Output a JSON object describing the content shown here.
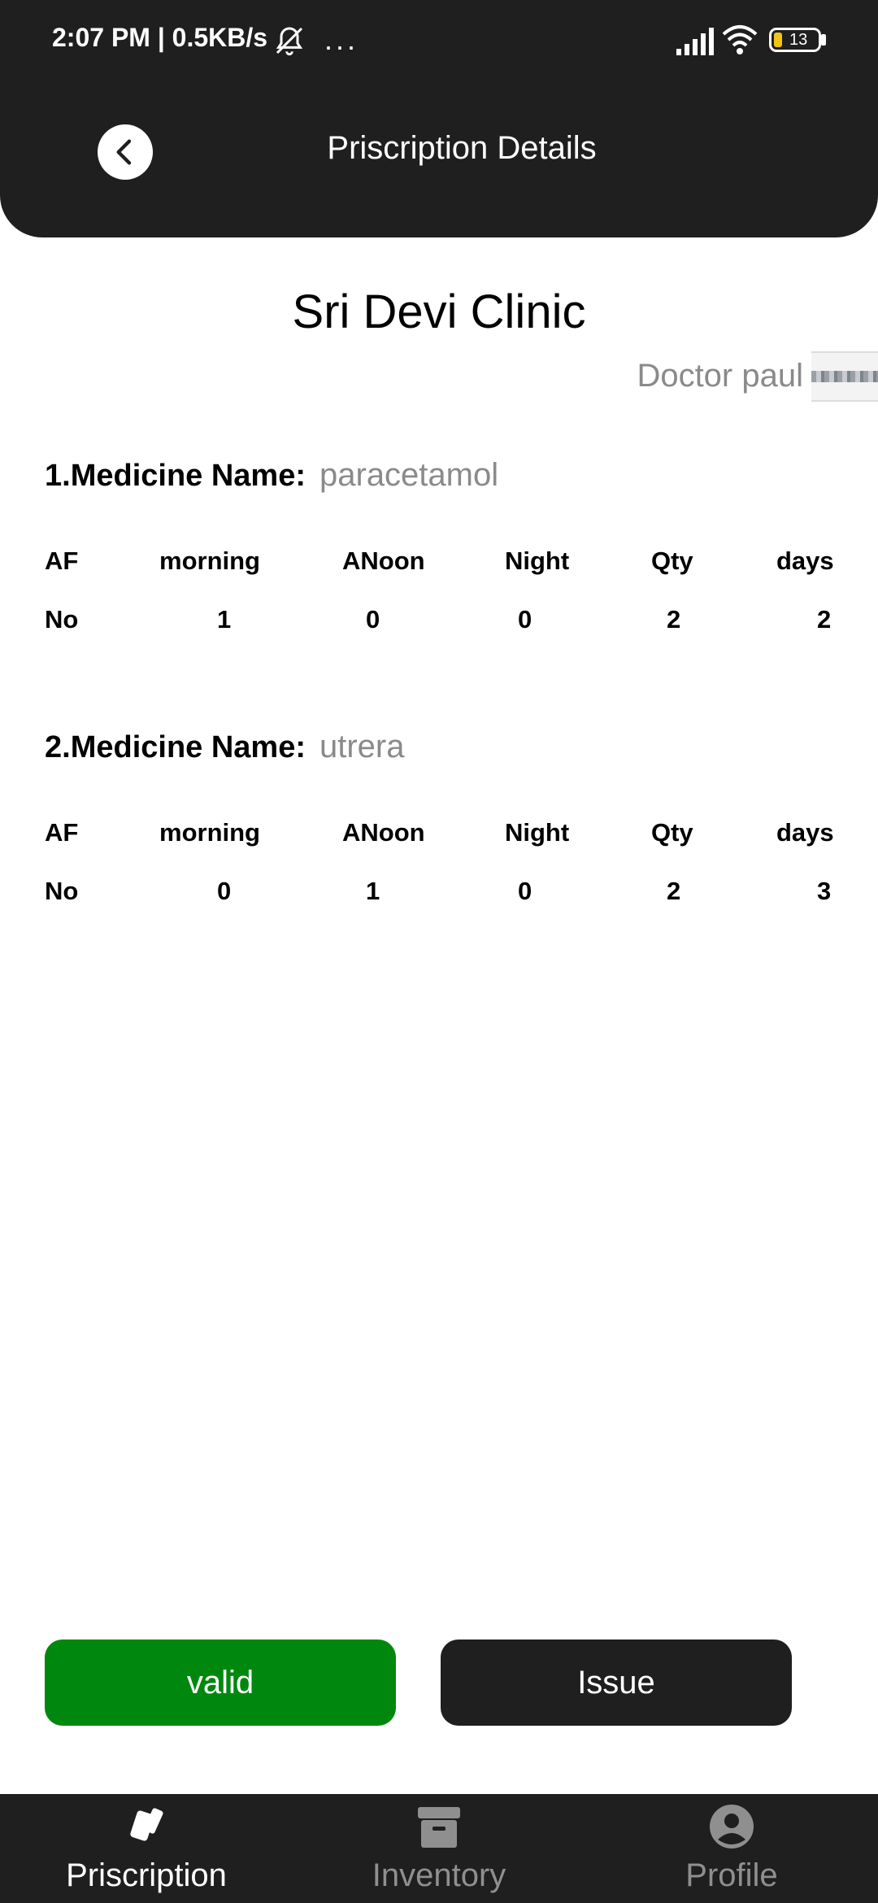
{
  "status_bar": {
    "time": "2:07 PM | 0.5KB/s",
    "more": "···",
    "battery": "13"
  },
  "app_bar": {
    "title": "Priscription Details"
  },
  "clinic": {
    "name": "Sri Devi Clinic",
    "doctor": "Doctor paul"
  },
  "table_headers": [
    "AF",
    "morning",
    "ANoon",
    "Night",
    "Qty",
    "days"
  ],
  "medicines": [
    {
      "label": "1.Medicine Name:",
      "name": "paracetamol",
      "values": [
        "No",
        "1",
        "0",
        "0",
        "2",
        "2"
      ]
    },
    {
      "label": "2.Medicine Name:",
      "name": "utrera",
      "values": [
        "No",
        "0",
        "1",
        "0",
        "2",
        "3"
      ]
    }
  ],
  "actions": {
    "valid_label": "valid",
    "issue_label": "Issue"
  },
  "nav": [
    {
      "label": "Priscription",
      "icon": "prescription-cards-icon",
      "active": true
    },
    {
      "label": "Inventory",
      "icon": "archive-box-icon",
      "active": false
    },
    {
      "label": "Profile",
      "icon": "account-circle-icon",
      "active": false
    }
  ],
  "colors": {
    "header": "#1f1f1f",
    "valid": "#00880e",
    "muted_text": "#8a8a8a",
    "nav_inactive": "#8f8f8f"
  }
}
